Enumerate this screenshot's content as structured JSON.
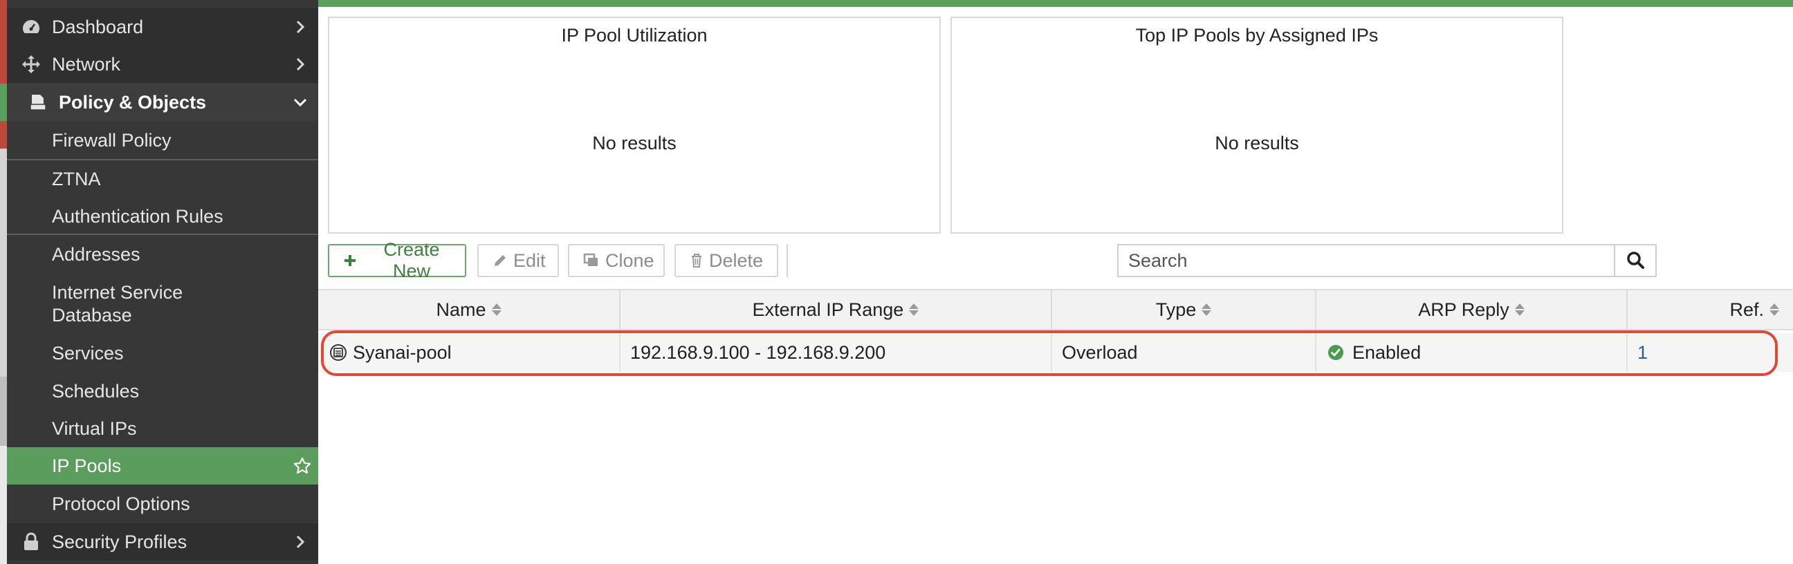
{
  "sidebar": {
    "items": [
      {
        "label": "Dashboard",
        "icon": "dashboard-icon"
      },
      {
        "label": "Network",
        "icon": "network-arrows-icon"
      },
      {
        "label": "Policy & Objects",
        "icon": "policy-icon"
      },
      {
        "label": "Firewall Policy"
      },
      {
        "label": "ZTNA"
      },
      {
        "label": "Authentication Rules"
      },
      {
        "label": "Addresses"
      },
      {
        "label": "Internet Service Database"
      },
      {
        "label": "Services"
      },
      {
        "label": "Schedules"
      },
      {
        "label": "Virtual IPs"
      },
      {
        "label": "IP Pools",
        "selected": true
      },
      {
        "label": "Protocol Options"
      },
      {
        "label": "Security Profiles",
        "icon": "lock-icon"
      }
    ]
  },
  "panels": {
    "utilization": {
      "title": "IP Pool Utilization",
      "empty": "No results"
    },
    "top_pools": {
      "title": "Top IP Pools by Assigned IPs",
      "empty": "No results"
    }
  },
  "toolbar": {
    "create_label": "Create New",
    "edit_label": "Edit",
    "clone_label": "Clone",
    "delete_label": "Delete",
    "search_placeholder": "Search"
  },
  "table": {
    "columns": [
      "Name",
      "External IP Range",
      "Type",
      "ARP Reply",
      "Ref."
    ],
    "rows": [
      {
        "name": "Syanai-pool",
        "range": "192.168.9.100 - 192.168.9.200",
        "type": "Overload",
        "arp": "Enabled",
        "ref": "1"
      }
    ]
  },
  "colors": {
    "accent_green": "#5b9d5c",
    "highlight_red": "#e04a35",
    "link_blue": "#2c5aa0"
  }
}
